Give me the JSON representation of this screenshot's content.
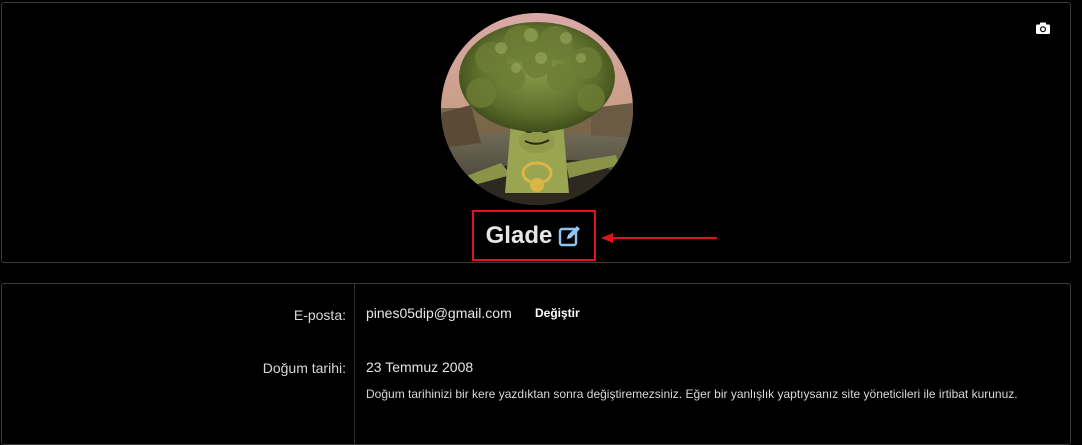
{
  "profile": {
    "username": "Glade",
    "avatar_icon": "broccoli-avatar",
    "camera_icon": "camera-icon",
    "edit_icon": "edit-icon",
    "highlight_color": "#e0141e"
  },
  "account": {
    "email_label": "E-posta:",
    "email_value": "pines05dip@gmail.com",
    "change_label": "Değiştir",
    "birthdate_label": "Doğum tarihi:",
    "birthdate_value": "23 Temmuz 2008",
    "birthdate_note": "Doğum tarihinizi bir kere yazdıktan sonra değiştiremezsiniz. Eğer bir yanlışlık yaptıysanız site yöneticileri ile irtibat kurunuz."
  }
}
